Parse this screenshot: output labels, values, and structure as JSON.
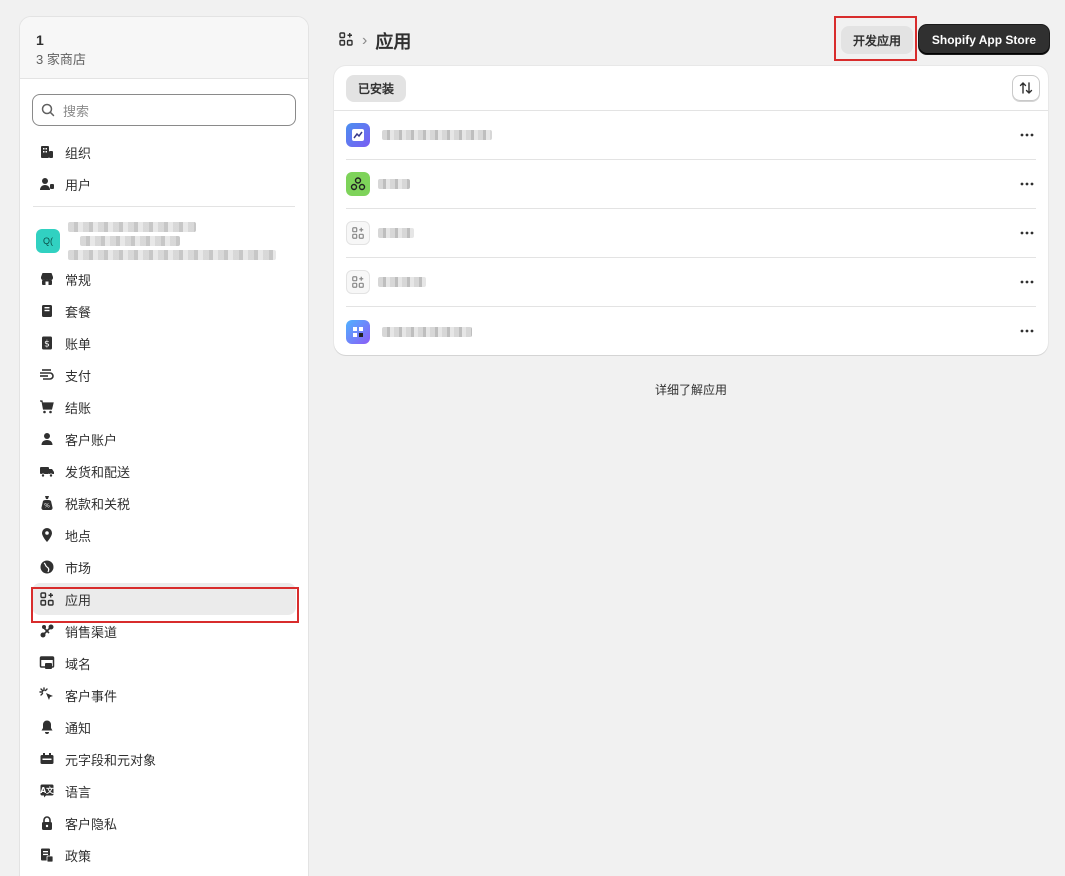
{
  "sidebar": {
    "store_name": "1",
    "store_count": "3 家商店",
    "search_placeholder": "搜索",
    "top_items": [
      {
        "label": "组织",
        "icon": "organization-icon"
      },
      {
        "label": "用户",
        "icon": "users-icon"
      }
    ],
    "store_avatar": "Q(",
    "items": [
      {
        "label": "常规",
        "icon": "store-icon"
      },
      {
        "label": "套餐",
        "icon": "plan-icon"
      },
      {
        "label": "账单",
        "icon": "billing-icon"
      },
      {
        "label": "支付",
        "icon": "payments-icon"
      },
      {
        "label": "结账",
        "icon": "cart-icon"
      },
      {
        "label": "客户账户",
        "icon": "person-icon"
      },
      {
        "label": "发货和配送",
        "icon": "truck-icon"
      },
      {
        "label": "税款和关税",
        "icon": "tax-icon"
      },
      {
        "label": "地点",
        "icon": "location-icon"
      },
      {
        "label": "市场",
        "icon": "globe-icon"
      },
      {
        "label": "应用",
        "icon": "apps-icon",
        "active": true
      },
      {
        "label": "销售渠道",
        "icon": "channels-icon"
      },
      {
        "label": "域名",
        "icon": "domain-icon"
      },
      {
        "label": "客户事件",
        "icon": "cursor-click-icon"
      },
      {
        "label": "通知",
        "icon": "bell-icon"
      },
      {
        "label": "元字段和元对象",
        "icon": "metafield-icon"
      },
      {
        "label": "语言",
        "icon": "language-icon"
      },
      {
        "label": "客户隐私",
        "icon": "lock-icon"
      },
      {
        "label": "政策",
        "icon": "policy-icon"
      }
    ]
  },
  "header": {
    "breadcrumb_icon": "apps-icon",
    "title": "应用",
    "develop_button": "开发应用",
    "app_store_button": "Shopify App Store"
  },
  "card": {
    "tab_installed": "已安装",
    "apps": [
      {
        "icon": "app-icon-blue-purple",
        "more": "more-icon"
      },
      {
        "icon": "app-icon-green",
        "more": "more-icon"
      },
      {
        "icon": "app-placeholder-icon",
        "more": "more-icon"
      },
      {
        "icon": "app-placeholder-icon",
        "more": "more-icon"
      },
      {
        "icon": "app-icon-gradient",
        "more": "more-icon"
      }
    ]
  },
  "footer": {
    "learn_more": "详细了解应用"
  },
  "colors": {
    "highlight_box": "#d82c2c",
    "primary_button": "#303030",
    "store_avatar": "#31d1c1"
  }
}
